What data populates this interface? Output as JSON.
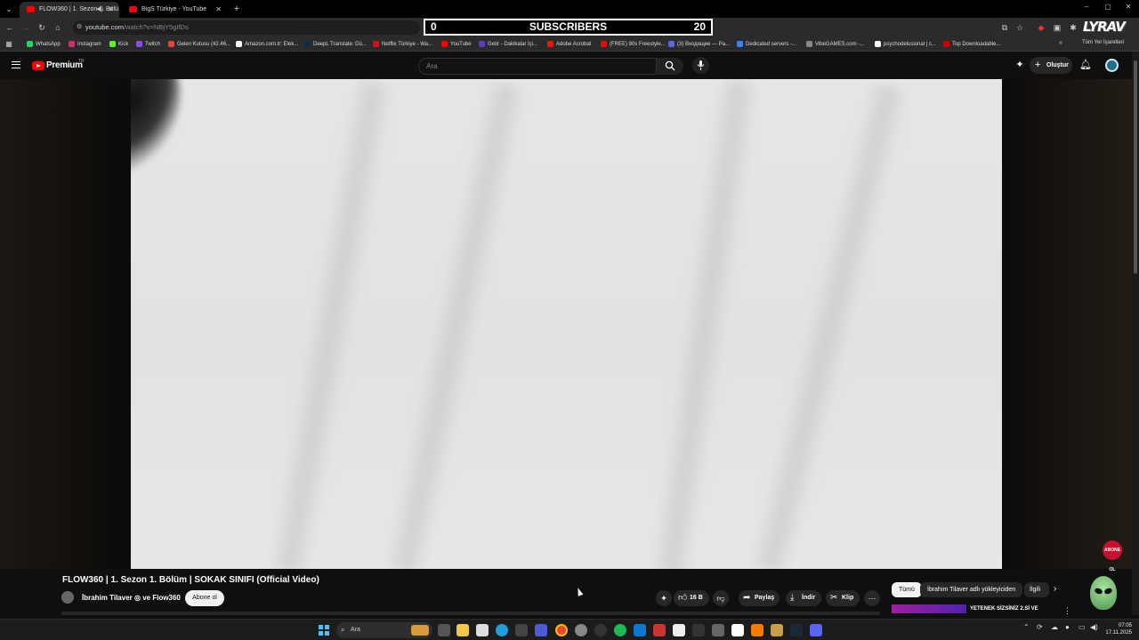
{
  "browser": {
    "tabs": [
      {
        "label": "FLOW360 | 1. Sezon 1. Bölü",
        "active": true
      },
      {
        "label": "BigS Türkiye - YouTube",
        "active": false
      }
    ],
    "url_host": "youtube.com",
    "url_path": "/watch?v=NBjY5gIfDs",
    "bookmarks": [
      "WhatsApp",
      "Instagram",
      "Kick",
      "Twitch",
      "Gelen Kutusu (42.46...",
      "Amazon.com.tr: Elek...",
      "DeepL Translate: Dü...",
      "Netflix Türkiye - Wa...",
      "YouTube",
      "Getir - Dakikalar İçi...",
      "Adobe Acrobat",
      "(FREE) 90s Freestyle...",
      "(3) Входящие — Pa...",
      "Dedicated servers -...",
      "VibeGAMES.com -...",
      "psychodelusional | c...",
      "Top Downloadable..."
    ],
    "all_bookmarks": "Tüm Yer İşaretleri",
    "extension_logo": "LYRAV"
  },
  "subscriber_counter": {
    "left": "0",
    "label": "SUBSCRIBERS",
    "right": "20"
  },
  "youtube": {
    "brand": "Premium",
    "region": "TR",
    "search_placeholder": "Ara",
    "create_label": "Oluştur",
    "video_title": "FLOW360 | 1. Sezon 1. Bölüm | SOKAK SINIFI (Official Video)",
    "channel": "İbrahim Tilaver ◎ ve Flow360",
    "subscribe_label": "Abone ol",
    "likes": "16 B",
    "share_label": "Paylaş",
    "download_label": "İndir",
    "clip_label": "Klip",
    "chips": [
      "Tümü",
      "İbrahim Tilaver adlı yükleyiciden",
      "İlgili"
    ],
    "rec_title": "YETENEK SİZSİNİZ 2.Sİ VE",
    "abone_badge": "ABONE OL"
  },
  "taskbar": {
    "search": "Ara",
    "time": "07:05",
    "date": "17.11.2025"
  },
  "colors": {
    "yt_red": "#ff0000",
    "accent_blue": "#4cc2ff"
  }
}
